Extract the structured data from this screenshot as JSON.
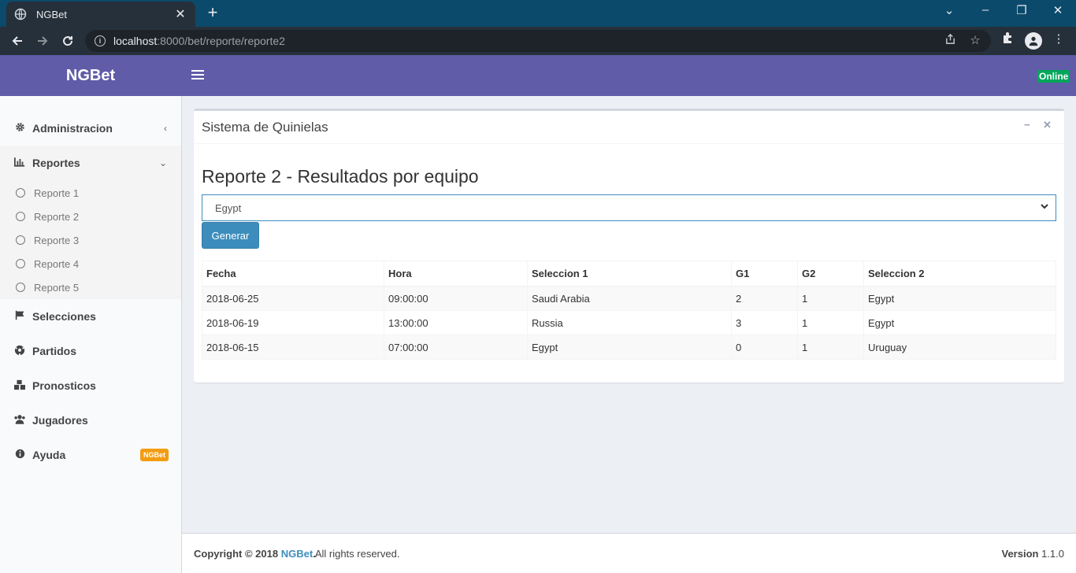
{
  "browser": {
    "tab_title": "NGBet",
    "url_host": "localhost",
    "url_rest": ":8000/bet/reporte/reporte2"
  },
  "header": {
    "logo": "NGBet",
    "status": "Online"
  },
  "sidebar": {
    "items": [
      {
        "label": "Administracion",
        "icon": "gear-icon"
      },
      {
        "label": "Reportes",
        "icon": "bar-chart-icon"
      },
      {
        "label": "Selecciones",
        "icon": "flag-icon"
      },
      {
        "label": "Partidos",
        "icon": "soccer-ball-icon"
      },
      {
        "label": "Pronosticos",
        "icon": "cubes-icon"
      },
      {
        "label": "Jugadores",
        "icon": "users-icon"
      },
      {
        "label": "Ayuda",
        "icon": "info-icon",
        "badge": "NGBet"
      }
    ],
    "sub_items": [
      "Reporte 1",
      "Reporte 2",
      "Reporte 3",
      "Reporte 4",
      "Reporte 5"
    ]
  },
  "main": {
    "box_title": "Sistema de Quinielas",
    "report_title": "Reporte 2 - Resultados por equipo",
    "select_value": "Egypt",
    "button_label": "Generar",
    "table": {
      "headers": [
        "Fecha",
        "Hora",
        "Seleccion 1",
        "G1",
        "G2",
        "Seleccion 2"
      ],
      "rows": [
        [
          "2018-06-25",
          "09:00:00",
          "Saudi Arabia",
          "2",
          "1",
          "Egypt"
        ],
        [
          "2018-06-19",
          "13:00:00",
          "Russia",
          "3",
          "1",
          "Egypt"
        ],
        [
          "2018-06-15",
          "07:00:00",
          "Egypt",
          "0",
          "1",
          "Uruguay"
        ]
      ]
    }
  },
  "footer": {
    "copyright": "Copyright © 2018",
    "brand": "NGBet",
    "rights": ". All rights reserved.",
    "version_label": "Version",
    "version": "1.1.0"
  },
  "colors": {
    "header": "#605ca8",
    "primary": "#3c8dbc",
    "success": "#00a65a",
    "warning": "#f39c12"
  }
}
